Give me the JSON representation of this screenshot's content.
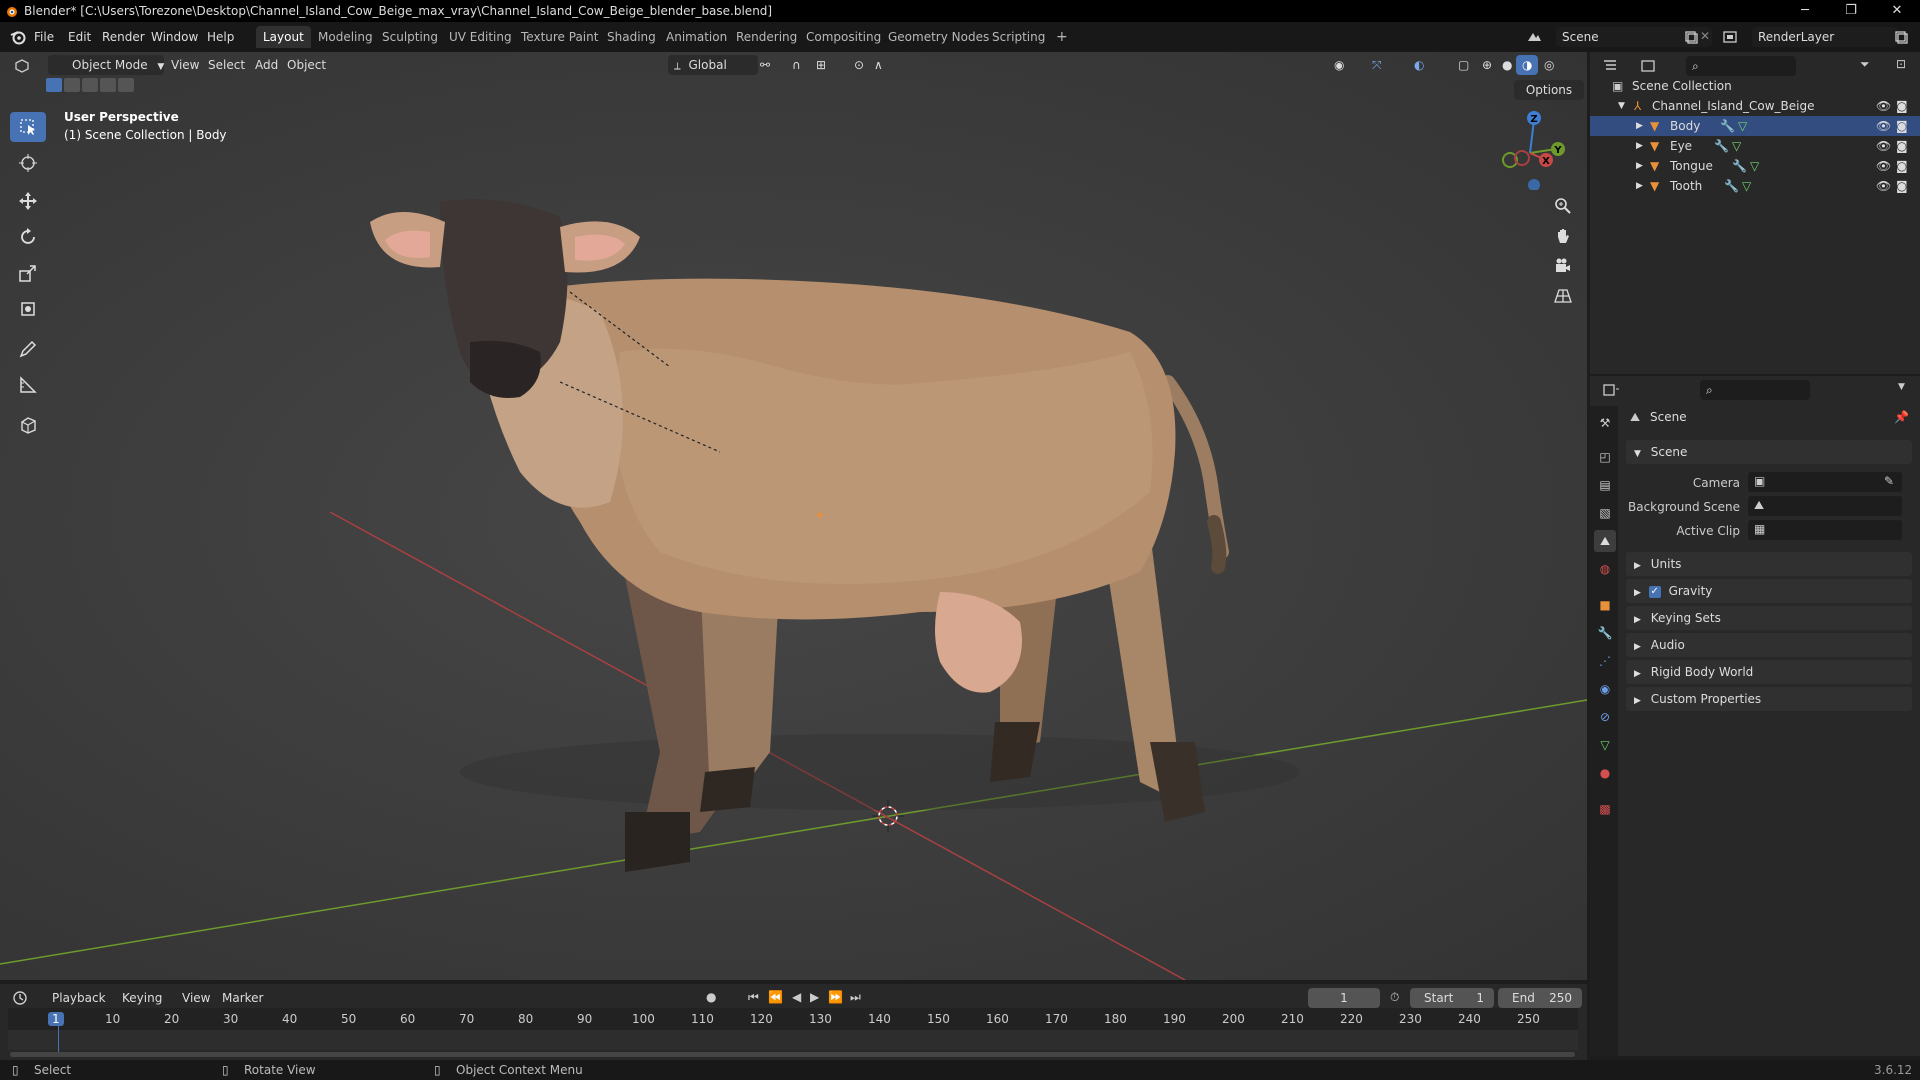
{
  "window": {
    "title": "Blender* [C:\\Users\\Torezone\\Desktop\\Channel_Island_Cow_Beige_max_vray\\Channel_Island_Cow_Beige_blender_base.blend]",
    "minimize": "─",
    "restore": "❐",
    "close": "✕"
  },
  "menus": [
    "File",
    "Edit",
    "Render",
    "Window",
    "Help"
  ],
  "workspaces": {
    "tabs": [
      "Layout",
      "Modeling",
      "Sculpting",
      "UV Editing",
      "Texture Paint",
      "Shading",
      "Animation",
      "Rendering",
      "Compositing",
      "Geometry Nodes",
      "Scripting"
    ],
    "add": "+",
    "active": "Layout"
  },
  "scene_selector": {
    "value": "Scene"
  },
  "layer_selector": {
    "value": "RenderLayer"
  },
  "viewport_header": {
    "mode": "Object Mode",
    "menus": [
      "View",
      "Select",
      "Add",
      "Object"
    ],
    "transform_orientation": "Global",
    "options": "Options"
  },
  "viewport_info": {
    "line1": "User Perspective",
    "line2": "(1) Scene Collection | Body"
  },
  "gizmo": {
    "z": "Z",
    "y": "Y",
    "x": "X"
  },
  "outliner": {
    "root": "Scene Collection",
    "collection": "Channel_Island_Cow_Beige",
    "objects": [
      "Body",
      "Eye",
      "Tongue",
      "Tooth"
    ],
    "selected": "Body"
  },
  "properties": {
    "context_title": "Scene",
    "panel_scene": "Scene",
    "camera_label": "Camera",
    "background_label": "Background Scene",
    "clip_label": "Active Clip",
    "panels": [
      "Units",
      "Gravity",
      "Keying Sets",
      "Audio",
      "Rigid Body World",
      "Custom Properties"
    ],
    "gravity_checked": true
  },
  "timeline": {
    "menus": [
      "Playback",
      "Keying",
      "View",
      "Marker"
    ],
    "current_frame": "1",
    "start_label": "Start",
    "start_value": "1",
    "end_label": "End",
    "end_value": "250",
    "ticks": [
      "1",
      "10",
      "20",
      "30",
      "40",
      "50",
      "60",
      "70",
      "80",
      "90",
      "100",
      "110",
      "120",
      "130",
      "140",
      "150",
      "160",
      "170",
      "180",
      "190",
      "200",
      "210",
      "220",
      "230",
      "240",
      "250"
    ]
  },
  "statusbar": {
    "select": "Select",
    "rotate": "Rotate View",
    "context": "Object Context Menu",
    "version": "3.6.12"
  },
  "colors": {
    "accent": "#4772b3",
    "x_axis": "#c84848",
    "y_axis": "#6e9a2c",
    "z_axis": "#3d7fd6",
    "mesh_orange": "#e8903a",
    "cow_body": "#b58f6e"
  }
}
